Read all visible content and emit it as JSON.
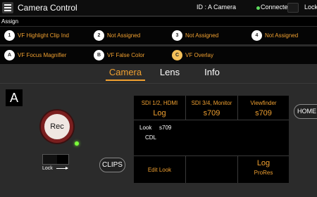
{
  "titlebar": {
    "title": "Camera Control",
    "camera_id": "ID : A Camera",
    "connection": "Connected",
    "lock_label": "Lock",
    "connected_color": "#5fdc5f"
  },
  "assign": {
    "label": "Assign",
    "buttons": [
      {
        "num": "1",
        "label": "VF Highlight Clip Ind"
      },
      {
        "num": "2",
        "label": "Not Assigned"
      },
      {
        "num": "3",
        "label": "Not Assigned"
      },
      {
        "num": "4",
        "label": "Not Assigned"
      },
      {
        "num": "A",
        "label": "VF Focus Magnifier"
      },
      {
        "num": "B",
        "label": "VF False Color"
      },
      {
        "num": "C",
        "label": "VF Overlay"
      }
    ]
  },
  "tabs": [
    {
      "label": "Camera",
      "active": true
    },
    {
      "label": "Lens",
      "active": false
    },
    {
      "label": "Info",
      "active": false
    }
  ],
  "camera": {
    "letter": "A",
    "rec_label": "Rec",
    "lock_label": "Lock",
    "clips_label": "CLIPS",
    "home_label": "HOME"
  },
  "outputs": {
    "columns": [
      {
        "header": "SDI 1/2, HDMI",
        "value": "Log"
      },
      {
        "header": "SDI 3/4, Monitor",
        "value": "s709"
      },
      {
        "header": "Viewfinder",
        "value": "s709"
      }
    ],
    "look_label": "Look",
    "look_value": "s709",
    "look_sub": "CDL",
    "edit_look": "Edit Look",
    "record_format_1": "Log",
    "record_format_2": "ProRes"
  },
  "colors": {
    "accent": "#f0a030",
    "rec_ring": "#7a1f1f",
    "tally": "#7cff3a"
  }
}
